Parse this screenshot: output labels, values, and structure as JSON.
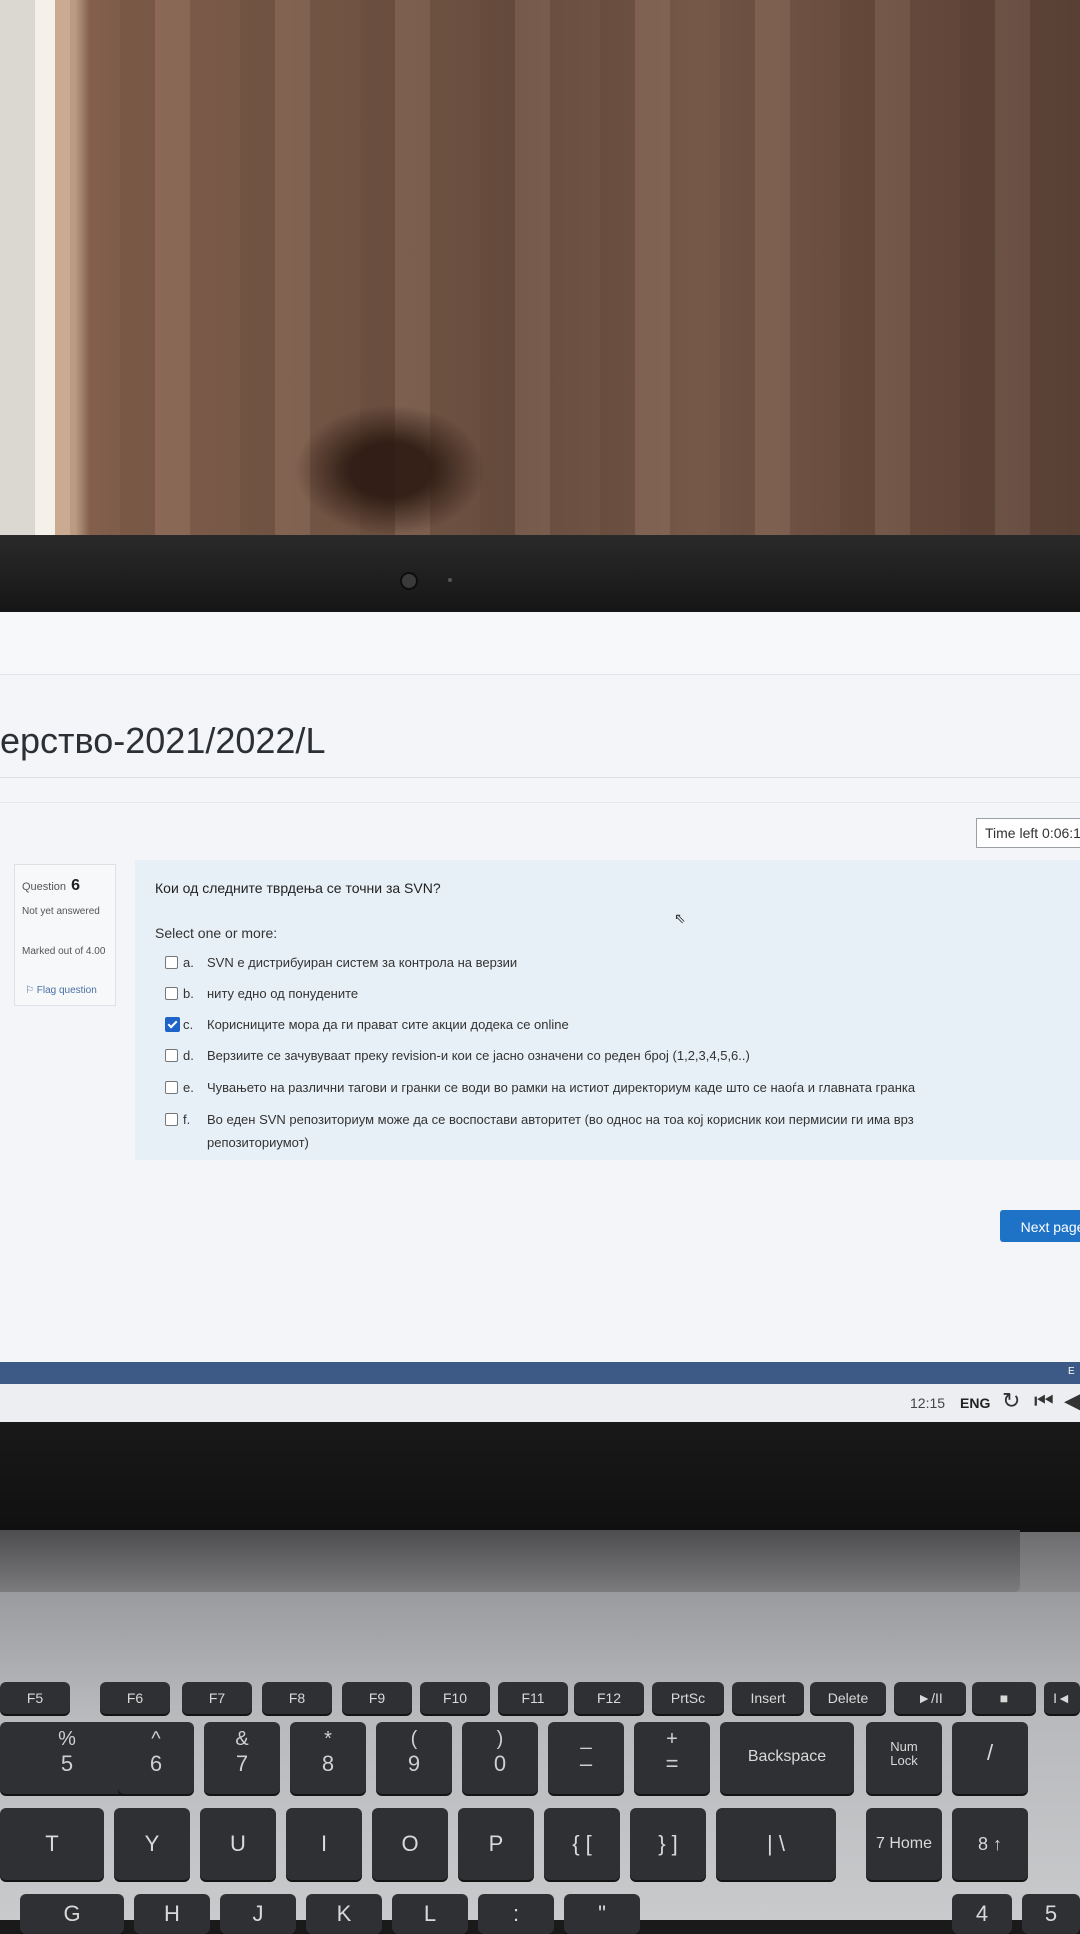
{
  "screen": {
    "course_title": "ерство-2021/2022/L",
    "timer_text": "Time left 0:06:1",
    "question_info": {
      "label": "Question",
      "number": "6",
      "state": "Not yet answered",
      "marked": "Marked out of 4.00",
      "flag": "Flag question"
    },
    "question_text": "Кои од следните тврдења се точни за SVN?",
    "select_label": "Select one or more:",
    "options": [
      {
        "letter": "a.",
        "text": "SVN е дистрибуиран систем за контрола на верзии",
        "checked": false
      },
      {
        "letter": "b.",
        "text": "ниту едно од понудените",
        "checked": false
      },
      {
        "letter": "c.",
        "text": "Корисниците мора да ги прават сите акции додека се online",
        "checked": true
      },
      {
        "letter": "d.",
        "text": "Верзиите се зачувуваат преку revision-и кои се јасно означени со реден број (1,2,3,4,5,6..)",
        "checked": false
      },
      {
        "letter": "e.",
        "text": "Чувањето на различни тагови и гранки се води во рамки на истиот директориум каде што се наоѓа и главната гранка",
        "checked": false
      },
      {
        "letter": "f.",
        "text": "Во еден SVN репозиториум може да се воспостави авторитет (во однос на тоа кој корисник кои пермисии ги има врз репозиториумот)",
        "checked": false
      }
    ],
    "next_button": "Next page",
    "footer_text": "E",
    "accent_color": "#1f73c7",
    "footer_color": "#3d5a87"
  },
  "taskbar": {
    "clock": "12:15",
    "language": "ENG",
    "icons": [
      "refresh-icon",
      "skip-back-icon",
      "volume-icon"
    ]
  },
  "keyboard": {
    "function_row": [
      "F5",
      "F6",
      "F7",
      "F8",
      "F9",
      "F10",
      "F11",
      "F12",
      "PrtSc",
      "Insert",
      "Delete",
      "►/II",
      "■",
      "I◄"
    ],
    "number_row": [
      {
        "top": "%",
        "bottom": "5"
      },
      {
        "top": "^",
        "bottom": "6"
      },
      {
        "top": "&",
        "bottom": "7"
      },
      {
        "top": "*",
        "bottom": "8"
      },
      {
        "top": "(",
        "bottom": "9"
      },
      {
        "top": ")",
        "bottom": "0"
      },
      {
        "top": "_",
        "bottom": "–"
      },
      {
        "top": "+",
        "bottom": "="
      },
      {
        "top": "",
        "bottom": "Backspace"
      },
      {
        "top": "Num",
        "bottom": "Lock"
      },
      {
        "top": "",
        "bottom": "/"
      }
    ],
    "letter_row": [
      "T",
      "Y",
      "U",
      "I",
      "O",
      "P",
      "{ [",
      "} ]",
      "| \\",
      "7 Home",
      "8 ↑"
    ],
    "bottom_row": [
      "G",
      "H",
      "J",
      "K",
      "L",
      ":",
      "\"",
      "4",
      "5"
    ]
  }
}
